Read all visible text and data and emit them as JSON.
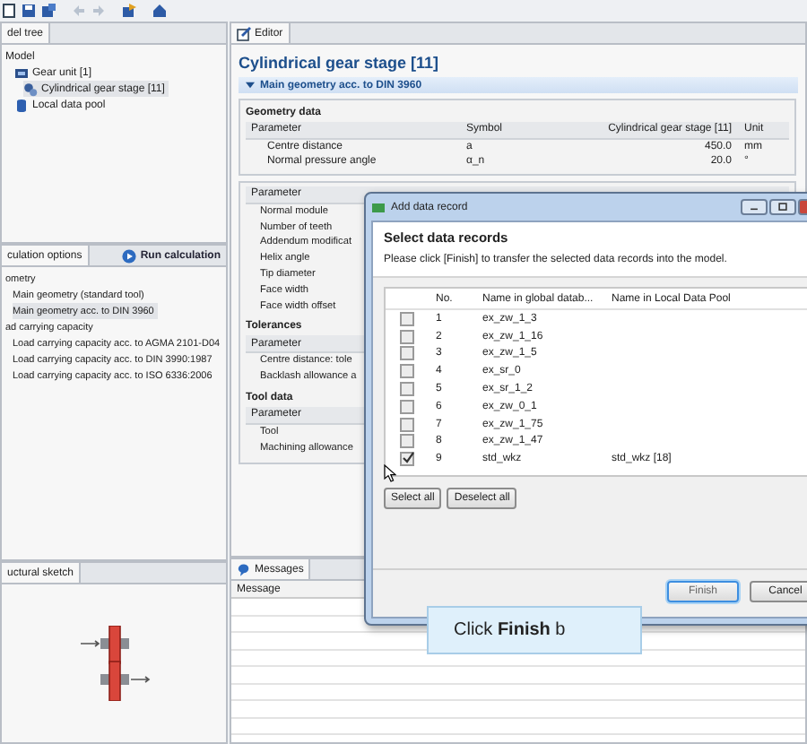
{
  "model_tree": {
    "tab": "del tree",
    "items": [
      {
        "label": "Model",
        "selected": false,
        "children": [
          {
            "label": "Gear unit [1]",
            "kind": "unit",
            "selected": false,
            "children": [
              {
                "label": "Cylindrical gear stage [11]",
                "kind": "stage",
                "selected": true
              }
            ]
          },
          {
            "label": "Local data pool",
            "kind": "pool",
            "selected": false
          }
        ]
      }
    ]
  },
  "calculation_options": {
    "tab": "culation options",
    "run_button": "Run calculation",
    "items": [
      {
        "label": "ometry",
        "selected": false,
        "children": [
          {
            "label": "Main geometry (standard tool)",
            "selected": false
          },
          {
            "label": "Main geometry acc. to DIN 3960",
            "selected": true
          }
        ]
      },
      {
        "label": "ad carrying capacity",
        "selected": false,
        "children": [
          {
            "label": "Load carrying capacity acc. to AGMA 2101-D04",
            "selected": false
          },
          {
            "label": "Load carrying capacity acc. to DIN 3990:1987",
            "selected": false
          },
          {
            "label": "Load carrying capacity acc. to ISO 6336:2006",
            "selected": false
          }
        ]
      }
    ]
  },
  "sketch": {
    "tab": "uctural sketch"
  },
  "editor": {
    "tab": "Editor",
    "title": "Cylindrical gear stage [11]",
    "section": "Main geometry acc. to DIN 3960",
    "geometry": {
      "heading": "Geometry data",
      "columns": [
        "Parameter",
        "Symbol",
        "Cylindrical gear stage [11]",
        "Unit"
      ],
      "rows": [
        [
          "Centre distance",
          "a",
          "450.0",
          "mm"
        ],
        [
          "Normal pressure angle",
          "α_n",
          "20.0",
          "°"
        ]
      ]
    },
    "groups": [
      {
        "column": "Parameter",
        "rows": [
          "Normal module",
          "Number of teeth",
          "Addendum modificat",
          "Helix angle",
          "Tip diameter",
          "Face width",
          "Face width offset"
        ]
      },
      {
        "heading": "Tolerances",
        "column": "Parameter",
        "rows": [
          "Centre distance: tole",
          "Backlash allowance a"
        ]
      },
      {
        "heading": "Tool data",
        "column": "Parameter",
        "rows": [
          "Tool",
          "Machining allowance"
        ]
      }
    ]
  },
  "messages": {
    "tab": "Messages",
    "column": "Message"
  },
  "dialog": {
    "title": "Add data record",
    "heading": "Select data records",
    "instruction": "Please click [Finish] to transfer the selected data records into the model.",
    "columns": [
      "No.",
      "Name in global datab...",
      "Name in Local Data Pool"
    ],
    "rows": [
      {
        "checked": false,
        "no": "1",
        "global_name": "ex_zw_1_3"
      },
      {
        "checked": false,
        "no": "2",
        "global_name": "ex_zw_1_16"
      },
      {
        "checked": false,
        "no": "3",
        "global_name": "ex_zw_1_5"
      },
      {
        "checked": false,
        "no": "4",
        "global_name": "ex_sr_0"
      },
      {
        "checked": false,
        "no": "5",
        "global_name": "ex_sr_1_2"
      },
      {
        "checked": false,
        "no": "6",
        "global_name": "ex_zw_0_1"
      },
      {
        "checked": false,
        "no": "7",
        "global_name": "ex_zw_1_75"
      },
      {
        "checked": false,
        "no": "8",
        "global_name": "ex_zw_1_47"
      },
      {
        "checked": true,
        "no": "9",
        "global_name": "std_wkz",
        "local_name": "std_wkz [18]"
      }
    ],
    "table_buttons": [
      "Select all",
      "Deselect all"
    ],
    "footer_buttons": [
      {
        "label": "Finish",
        "focused": true
      },
      {
        "label": "Cancel",
        "focused": false
      }
    ]
  },
  "callout": {
    "text": "Click **Finish** b"
  }
}
